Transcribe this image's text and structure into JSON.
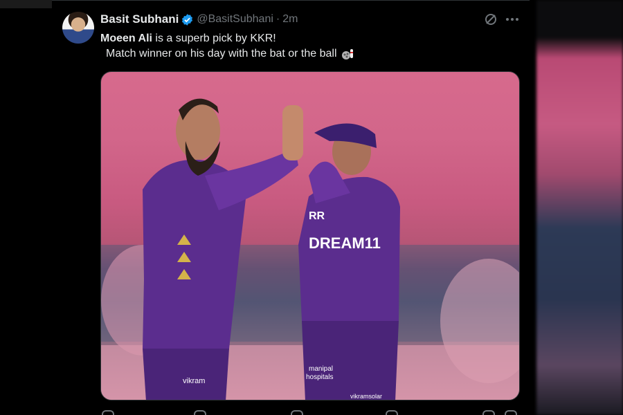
{
  "tweet": {
    "display_name": "Basit Subhani",
    "handle": "@BasitSubhani",
    "separator": "·",
    "time": "2m",
    "text_bold": "Moeen Ali",
    "text_rest": " is a superb pick by KKR!",
    "text_line2": "Match winner on his day with the bat or the ball"
  },
  "icons": {
    "verified": "verified-badge-icon",
    "grok": "grok-icon",
    "more": "more-options-icon",
    "emoji": "cricket-emoji-icon"
  },
  "image": {
    "jersey_text": "DREAM11",
    "sleeve_text_1": "RR",
    "sponsor_left": "vikram",
    "sponsor_right_1": "manipal",
    "sponsor_right_2": "hospitals",
    "sponsor_right_3": "vikramsolar"
  },
  "colors": {
    "background": "#000000",
    "text": "#e7e9ea",
    "secondary_text": "#71767b",
    "verified_blue": "#1d9bf0",
    "jersey_purple": "#5b2d8e"
  }
}
